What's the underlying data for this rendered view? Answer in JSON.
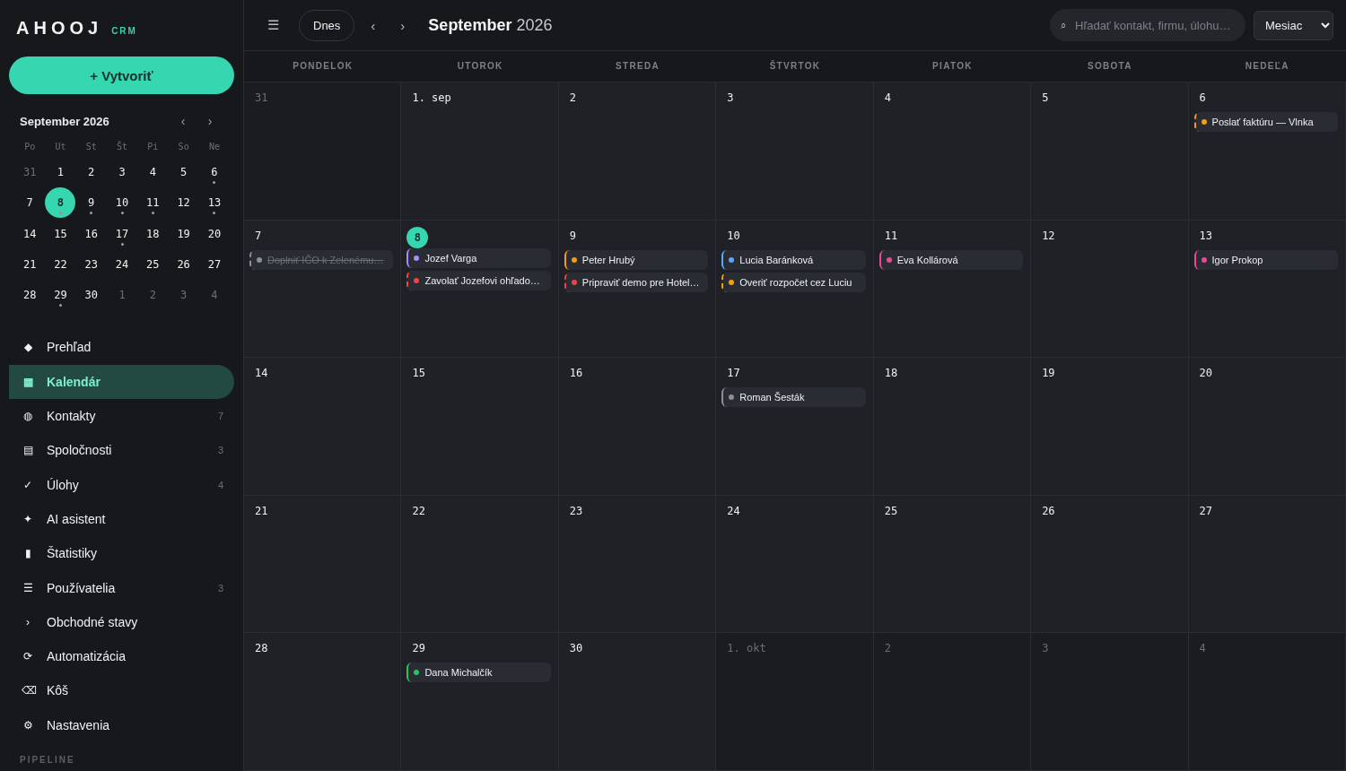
{
  "brand": {
    "name": "AHOOJ",
    "tag": "CRM"
  },
  "create_button": "+ Vytvoriť",
  "mini_calendar": {
    "title": "September 2026",
    "prev": "‹",
    "next": "›",
    "weekdays": [
      "Po",
      "Ut",
      "St",
      "Št",
      "Pi",
      "So",
      "Ne"
    ],
    "days": [
      {
        "label": "31",
        "in_month": false,
        "selected": false,
        "has_events": false
      },
      {
        "label": "1",
        "in_month": true,
        "selected": false,
        "has_events": false
      },
      {
        "label": "2",
        "in_month": true,
        "selected": false,
        "has_events": false
      },
      {
        "label": "3",
        "in_month": true,
        "selected": false,
        "has_events": false
      },
      {
        "label": "4",
        "in_month": true,
        "selected": false,
        "has_events": false
      },
      {
        "label": "5",
        "in_month": true,
        "selected": false,
        "has_events": false
      },
      {
        "label": "6",
        "in_month": true,
        "selected": false,
        "has_events": true
      },
      {
        "label": "7",
        "in_month": true,
        "selected": false,
        "has_events": false
      },
      {
        "label": "8",
        "in_month": true,
        "selected": true,
        "has_events": true
      },
      {
        "label": "9",
        "in_month": true,
        "selected": false,
        "has_events": true
      },
      {
        "label": "10",
        "in_month": true,
        "selected": false,
        "has_events": true
      },
      {
        "label": "11",
        "in_month": true,
        "selected": false,
        "has_events": true
      },
      {
        "label": "12",
        "in_month": true,
        "selected": false,
        "has_events": false
      },
      {
        "label": "13",
        "in_month": true,
        "selected": false,
        "has_events": true
      },
      {
        "label": "14",
        "in_month": true,
        "selected": false,
        "has_events": false
      },
      {
        "label": "15",
        "in_month": true,
        "selected": false,
        "has_events": false
      },
      {
        "label": "16",
        "in_month": true,
        "selected": false,
        "has_events": false
      },
      {
        "label": "17",
        "in_month": true,
        "selected": false,
        "has_events": true
      },
      {
        "label": "18",
        "in_month": true,
        "selected": false,
        "has_events": false
      },
      {
        "label": "19",
        "in_month": true,
        "selected": false,
        "has_events": false
      },
      {
        "label": "20",
        "in_month": true,
        "selected": false,
        "has_events": false
      },
      {
        "label": "21",
        "in_month": true,
        "selected": false,
        "has_events": false
      },
      {
        "label": "22",
        "in_month": true,
        "selected": false,
        "has_events": false
      },
      {
        "label": "23",
        "in_month": true,
        "selected": false,
        "has_events": false
      },
      {
        "label": "24",
        "in_month": true,
        "selected": false,
        "has_events": false
      },
      {
        "label": "25",
        "in_month": true,
        "selected": false,
        "has_events": false
      },
      {
        "label": "26",
        "in_month": true,
        "selected": false,
        "has_events": false
      },
      {
        "label": "27",
        "in_month": true,
        "selected": false,
        "has_events": false
      },
      {
        "label": "28",
        "in_month": true,
        "selected": false,
        "has_events": false
      },
      {
        "label": "29",
        "in_month": true,
        "selected": false,
        "has_events": true
      },
      {
        "label": "30",
        "in_month": true,
        "selected": false,
        "has_events": false
      },
      {
        "label": "1",
        "in_month": false,
        "selected": false,
        "has_events": false
      },
      {
        "label": "2",
        "in_month": false,
        "selected": false,
        "has_events": false
      },
      {
        "label": "3",
        "in_month": false,
        "selected": false,
        "has_events": false
      },
      {
        "label": "4",
        "in_month": false,
        "selected": false,
        "has_events": false
      }
    ]
  },
  "nav": [
    {
      "icon": "◆",
      "label": "Prehľad",
      "selected": false
    },
    {
      "icon": "▦",
      "label": "Kalendár",
      "selected": true
    },
    {
      "icon": "◍",
      "label": "Kontakty",
      "count": "7",
      "selected": false
    },
    {
      "icon": "▤",
      "label": "Spoločnosti",
      "count": "3",
      "selected": false
    },
    {
      "icon": "✓",
      "label": "Úlohy",
      "count": "4",
      "selected": false
    },
    {
      "icon": "✦",
      "label": "AI asistent",
      "selected": false
    },
    {
      "icon": "▮",
      "label": "Štatistiky",
      "selected": false
    },
    {
      "icon": "☰",
      "label": "Používatelia",
      "count": "3",
      "selected": false
    },
    {
      "icon": "›",
      "label": "Obchodné stavy",
      "selected": false
    },
    {
      "icon": "⟳",
      "label": "Automatizácia",
      "selected": false
    },
    {
      "icon": "⌫",
      "label": "Kôš",
      "selected": false
    },
    {
      "icon": "⚙",
      "label": "Nastavenia",
      "selected": false
    }
  ],
  "section_label": "PIPELINE",
  "toolbar": {
    "menu": "☰",
    "today": "Dnes",
    "prev": "‹",
    "next": "›",
    "title_month": "September",
    "title_year": "2026",
    "search": {
      "icon": "⌕",
      "placeholder": "Hľadať kontakt, firmu, úlohu…"
    },
    "view": "Mesiac"
  },
  "weekdays": [
    "PONDELOK",
    "UTOROK",
    "STREDA",
    "ŠTVRTOK",
    "PIATOK",
    "SOBOTA",
    "NEDEĽA"
  ],
  "weeks": [
    {
      "days": [
        {
          "label": "31",
          "in_month": false,
          "today": false
        },
        {
          "label": "1. sep",
          "in_month": true,
          "today": false
        },
        {
          "label": "2",
          "in_month": true,
          "today": false
        },
        {
          "label": "3",
          "in_month": true,
          "today": false
        },
        {
          "label": "4",
          "in_month": true,
          "today": false
        },
        {
          "label": "5",
          "in_month": true,
          "today": false
        },
        {
          "label": "6",
          "in_month": true,
          "today": false,
          "events": [
            {
              "kind": "task",
              "title": "Poslať faktúru — Vlnka",
              "color": "#f59e0b",
              "done": false
            }
          ]
        }
      ]
    },
    {
      "days": [
        {
          "label": "7",
          "in_month": true,
          "today": false,
          "events": [
            {
              "kind": "task",
              "title": "Doplniť IČO k Zelenému…",
              "color": "#8b8f98",
              "done": true
            }
          ]
        },
        {
          "label": "8",
          "in_month": true,
          "today": true,
          "events": [
            {
              "kind": "contact",
              "title": "Jozef Varga",
              "color": "#a78bfa"
            },
            {
              "kind": "task",
              "title": "Zavolať Jozefovi ohľado…",
              "color": "#ef4444",
              "done": false
            }
          ]
        },
        {
          "label": "9",
          "in_month": true,
          "today": false,
          "events": [
            {
              "kind": "contact",
              "title": "Peter Hrubý",
              "color": "#f59e0b"
            },
            {
              "kind": "task",
              "title": "Pripraviť demo pre Hotel…",
              "color": "#ef4444",
              "done": false
            }
          ]
        },
        {
          "label": "10",
          "in_month": true,
          "today": false,
          "events": [
            {
              "kind": "contact",
              "title": "Lucia Baránková",
              "color": "#60a5fa"
            },
            {
              "kind": "task",
              "title": "Overiť rozpočet cez Luciu",
              "color": "#f59e0b",
              "done": false
            }
          ]
        },
        {
          "label": "11",
          "in_month": true,
          "today": false,
          "events": [
            {
              "kind": "contact",
              "title": "Eva Kollárová",
              "color": "#ec4899"
            }
          ]
        },
        {
          "label": "12",
          "in_month": true,
          "today": false
        },
        {
          "label": "13",
          "in_month": true,
          "today": false,
          "events": [
            {
              "kind": "contact",
              "title": "Igor Prokop",
              "color": "#ec4899"
            }
          ]
        }
      ]
    },
    {
      "days": [
        {
          "label": "14",
          "in_month": true,
          "today": false
        },
        {
          "label": "15",
          "in_month": true,
          "today": false
        },
        {
          "label": "16",
          "in_month": true,
          "today": false
        },
        {
          "label": "17",
          "in_month": true,
          "today": false,
          "events": [
            {
              "kind": "contact",
              "title": "Roman Šesták",
              "color": "#8b8f98"
            }
          ]
        },
        {
          "label": "18",
          "in_month": true,
          "today": false
        },
        {
          "label": "19",
          "in_month": true,
          "today": false
        },
        {
          "label": "20",
          "in_month": true,
          "today": false
        }
      ]
    },
    {
      "days": [
        {
          "label": "21",
          "in_month": true,
          "today": false
        },
        {
          "label": "22",
          "in_month": true,
          "today": false
        },
        {
          "label": "23",
          "in_month": true,
          "today": false
        },
        {
          "label": "24",
          "in_month": true,
          "today": false
        },
        {
          "label": "25",
          "in_month": true,
          "today": false
        },
        {
          "label": "26",
          "in_month": true,
          "today": false
        },
        {
          "label": "27",
          "in_month": true,
          "today": false
        }
      ]
    },
    {
      "days": [
        {
          "label": "28",
          "in_month": true,
          "today": false
        },
        {
          "label": "29",
          "in_month": true,
          "today": false,
          "events": [
            {
              "kind": "contact",
              "title": "Dana Michalčík",
              "color": "#22c55e"
            }
          ]
        },
        {
          "label": "30",
          "in_month": true,
          "today": false
        },
        {
          "label": "1. okt",
          "in_month": false,
          "today": false
        },
        {
          "label": "2",
          "in_month": false,
          "today": false
        },
        {
          "label": "3",
          "in_month": false,
          "today": false
        },
        {
          "label": "4",
          "in_month": false,
          "today": false
        }
      ]
    }
  ]
}
